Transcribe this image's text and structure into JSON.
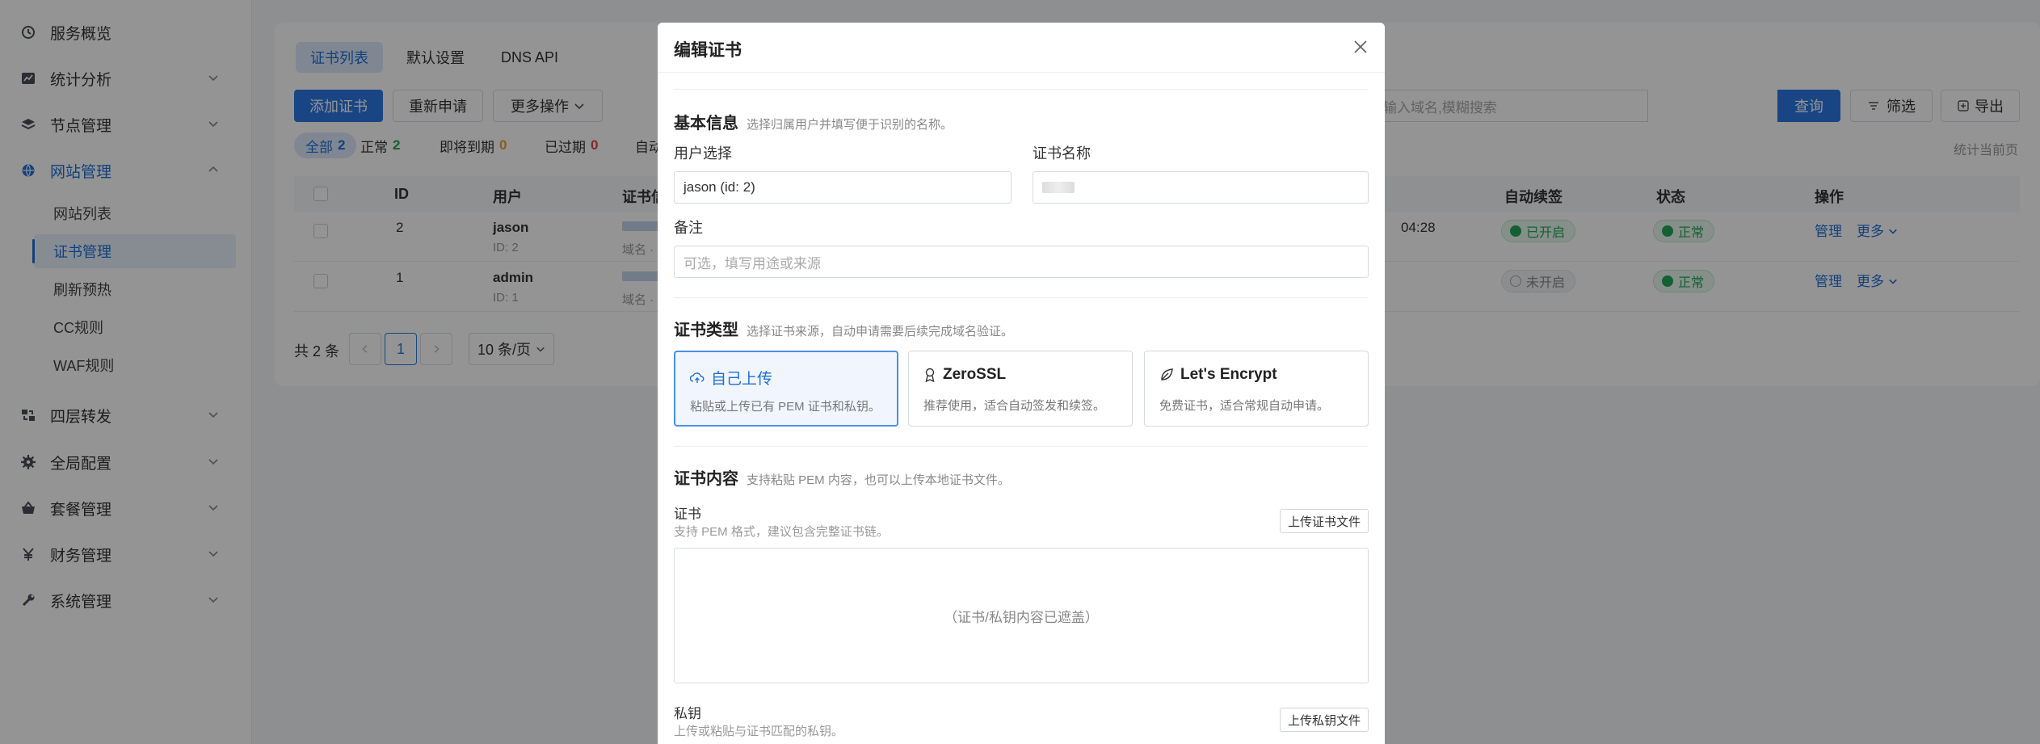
{
  "sidebar": {
    "items": [
      {
        "label": "服务概览",
        "icon": "dashboard-icon"
      },
      {
        "label": "统计分析",
        "icon": "chart-icon"
      },
      {
        "label": "节点管理",
        "icon": "layers-icon"
      },
      {
        "label": "网站管理",
        "icon": "globe-icon"
      },
      {
        "label": "四层转发",
        "icon": "forward-icon"
      },
      {
        "label": "全局配置",
        "icon": "gear-icon"
      },
      {
        "label": "套餐管理",
        "icon": "basket-icon"
      },
      {
        "label": "财务管理",
        "icon": "yen-icon"
      },
      {
        "label": "系统管理",
        "icon": "wrench-icon"
      }
    ],
    "sub_items": [
      "网站列表",
      "证书管理",
      "刷新预热",
      "CC规则",
      "WAF规则"
    ]
  },
  "main": {
    "tabs": [
      "证书列表",
      "默认设置",
      "DNS API"
    ],
    "buttons": {
      "add": "添加证书",
      "reapply": "重新申请",
      "more_ops": "更多操作"
    },
    "search": {
      "placeholder": "输入域名,模糊搜索",
      "query": "查询",
      "filter": "筛选",
      "export": "导出"
    },
    "filters": [
      {
        "label": "全部",
        "count": "2"
      },
      {
        "label": "正常",
        "count": "2"
      },
      {
        "label": "即将到期",
        "count": "0"
      },
      {
        "label": "已过期",
        "count": "0"
      },
      {
        "label": "自动"
      }
    ],
    "stat_note": "统计当前页",
    "columns": [
      "ID",
      "用户",
      "证书信",
      "自动续签",
      "状态",
      "操作"
    ],
    "rows": [
      {
        "id": "2",
        "user": "jason",
        "user_sub": "ID: 2",
        "domain_label": "域名 ·",
        "time": "04:28",
        "renew": "已开启",
        "status": "正常",
        "manage": "管理",
        "more": "更多"
      },
      {
        "id": "1",
        "user": "admin",
        "user_sub": "ID: 1",
        "domain_label": "域名 ·",
        "renew": "未开启",
        "status": "正常",
        "manage": "管理",
        "more": "更多"
      }
    ],
    "pager": {
      "total": "共 2 条",
      "page": "1",
      "size": "10 条/页"
    }
  },
  "modal": {
    "title": "编辑证书",
    "basic": {
      "title": "基本信息",
      "desc": "选择归属用户并填写便于识别的名称。",
      "user_label": "用户选择",
      "user_value": "jason (id: 2)",
      "name_label": "证书名称",
      "remark_label": "备注",
      "remark_placeholder": "可选，填写用途或来源"
    },
    "type": {
      "title": "证书类型",
      "desc": "选择证书来源，自动申请需要后续完成域名验证。",
      "options": [
        {
          "title": "自己上传",
          "desc": "粘贴或上传已有 PEM 证书和私钥。",
          "icon": "cloud-upload-icon"
        },
        {
          "title": "ZeroSSL",
          "desc": "推荐使用，适合自动签发和续签。",
          "icon": "award-icon"
        },
        {
          "title": "Let's Encrypt",
          "desc": "免费证书，适合常规自动申请。",
          "icon": "leaf-icon"
        }
      ]
    },
    "content": {
      "title": "证书内容",
      "desc": "支持粘贴 PEM 内容，也可以上传本地证书文件。",
      "cert_label": "证书",
      "cert_help": "支持 PEM 格式，建议包含完整证书链。",
      "upload_cert": "上传证书文件",
      "masked": "（证书/私钥内容已遮盖）",
      "key_label": "私钥",
      "key_help": "上传或粘贴与证书匹配的私钥。",
      "upload_key": "上传私钥文件"
    }
  },
  "colors": {
    "accent": "#2b78e4",
    "success": "#22a559",
    "warning": "#e8a33b",
    "danger": "#e5484d"
  }
}
